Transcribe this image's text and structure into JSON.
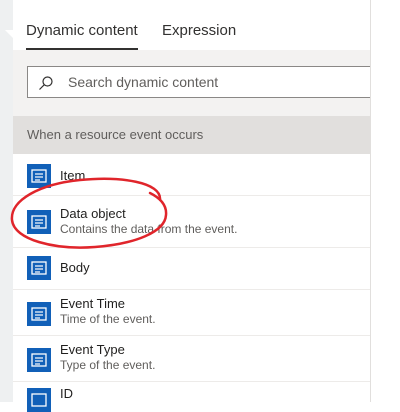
{
  "tabs": [
    {
      "label": "Dynamic content",
      "active": true
    },
    {
      "label": "Expression",
      "active": false
    }
  ],
  "search": {
    "placeholder": "Search dynamic content",
    "value": ""
  },
  "section": {
    "title": "When a resource event occurs"
  },
  "items": [
    {
      "title": "Item",
      "description": ""
    },
    {
      "title": "Data object",
      "description": "Contains the data from the event."
    },
    {
      "title": "Body",
      "description": ""
    },
    {
      "title": "Event Time",
      "description": "Time of the event."
    },
    {
      "title": "Event Type",
      "description": "Type of the event."
    },
    {
      "title": "ID",
      "description": ""
    }
  ],
  "colors": {
    "icon_bg": "#1160b8",
    "annotation": "#e0252b",
    "section_bg": "#e1dfdd"
  },
  "icons": {
    "item": "event-grid-icon",
    "search": "search-icon"
  }
}
